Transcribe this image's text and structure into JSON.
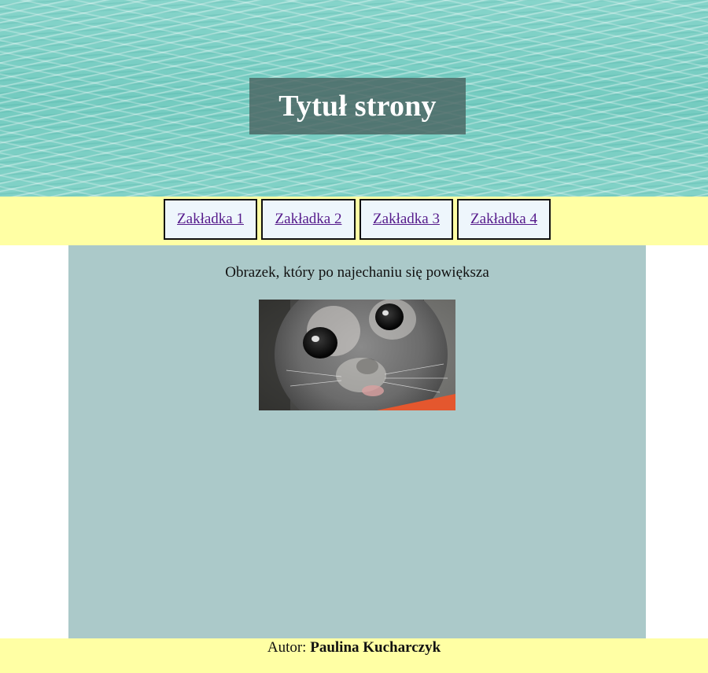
{
  "header": {
    "title": "Tytuł strony",
    "background_color": "#7fd0c6"
  },
  "nav": {
    "tabs": [
      {
        "label": "Zakładka 1"
      },
      {
        "label": "Zakładka 2"
      },
      {
        "label": "Zakładka 3"
      },
      {
        "label": "Zakładka 4"
      }
    ],
    "background_color": "#ffffa4",
    "link_color": "#551a8b"
  },
  "main": {
    "caption": "Obrazek, który po najechaniu się powiększa",
    "image_subject": "seal-photo",
    "background_color": "#abc9c9"
  },
  "footer": {
    "author_prefix": "Autor:",
    "author_name": "Paulina Kucharczyk"
  }
}
